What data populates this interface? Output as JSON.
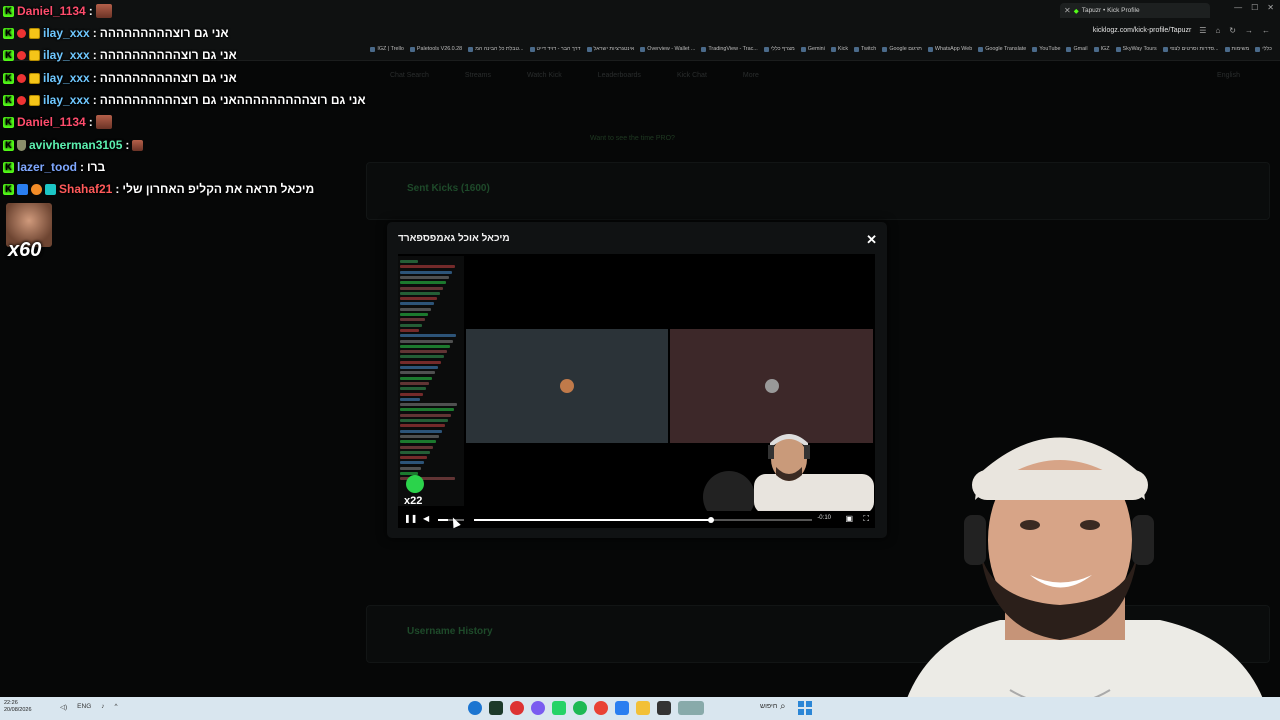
{
  "browser": {
    "tab_title": "Tapuzr • Kick Profile",
    "url": "kicklogz.com/kick-profile/Tapuzr",
    "bookmarks": [
      "IGZ | Trello",
      "Paletools V26.0.28",
      "טבלת כל הבינה המ...",
      "דרך הבר - דויד דייט",
      "אינטגרציות ישראל",
      "Overview - Wallet ...",
      "TradingView - Trac...",
      "מצרף כללי",
      "Gemini",
      "Kick",
      "Twitch",
      "Google תרגום",
      "WhatsApp Web",
      "Google Translate",
      "YouTube",
      "Gmail",
      "IGZ",
      "SkyWay Tours",
      "סדרות וסרטים לצפי...",
      "משימות",
      "כללי"
    ]
  },
  "chat": [
    {
      "user": "Daniel_1134",
      "color": "#ff4d6d",
      "message": "",
      "emote": true,
      "badges": [
        "kick"
      ]
    },
    {
      "user": "ilay_xxx",
      "color": "#6fc8ff",
      "message": "אני גם רוצההההההההה",
      "badges": [
        "kick",
        "vip",
        "sub"
      ]
    },
    {
      "user": "ilay_xxx",
      "color": "#6fc8ff",
      "message": "אני גם רוצהההההההההה",
      "badges": [
        "kick",
        "vip",
        "sub"
      ]
    },
    {
      "user": "ilay_xxx",
      "color": "#6fc8ff",
      "message": "אני גם רוצהההההההההה",
      "badges": [
        "kick",
        "vip",
        "sub"
      ]
    },
    {
      "user": "ilay_xxx",
      "color": "#6fc8ff",
      "message": "אני גם רוצהההההההההאני גם רוצהההההההההה",
      "badges": [
        "kick",
        "vip",
        "sub"
      ]
    },
    {
      "user": "Daniel_1134",
      "color": "#ff4d6d",
      "message": "",
      "emote": true,
      "badges": [
        "kick"
      ]
    },
    {
      "user": "avivherman3105",
      "color": "#5cf0b0",
      "message": "",
      "emote_small": true,
      "badges": [
        "kick",
        "shield"
      ]
    },
    {
      "user": "lazer_tood",
      "color": "#7fa8ff",
      "message": "ברו",
      "badges": [
        "kick"
      ]
    },
    {
      "user": "Shahaf21",
      "color": "#ff5a5a",
      "message": "מיכאל תראה את הקליפ האחרון שלי",
      "badges": [
        "kick",
        "blue",
        "orange",
        "teal"
      ]
    }
  ],
  "big_emote": {
    "label": "x60"
  },
  "modal": {
    "title": "מיכאל אוכל גאמפספארד",
    "close_icon": "close-icon",
    "time": "-0:10",
    "progress": 0.7,
    "pip_label": "x22"
  },
  "page": {
    "nav": [
      "Chat Search",
      "Streams",
      "Watch Kick",
      "Leaderboards",
      "Kick Chat",
      "More"
    ],
    "lang": "English",
    "link": "Want to see the time PRO?",
    "section_1": "Sent Kicks (1600)",
    "section_2": "Username History"
  },
  "taskbar": {
    "time": "22:26",
    "date": "20/08/2026",
    "lang": "ENG",
    "search": "חיפוש"
  },
  "colors": {
    "kick_green": "#53fc18",
    "modal_bg": "#101213",
    "taskbar": "#d9e6ef"
  }
}
